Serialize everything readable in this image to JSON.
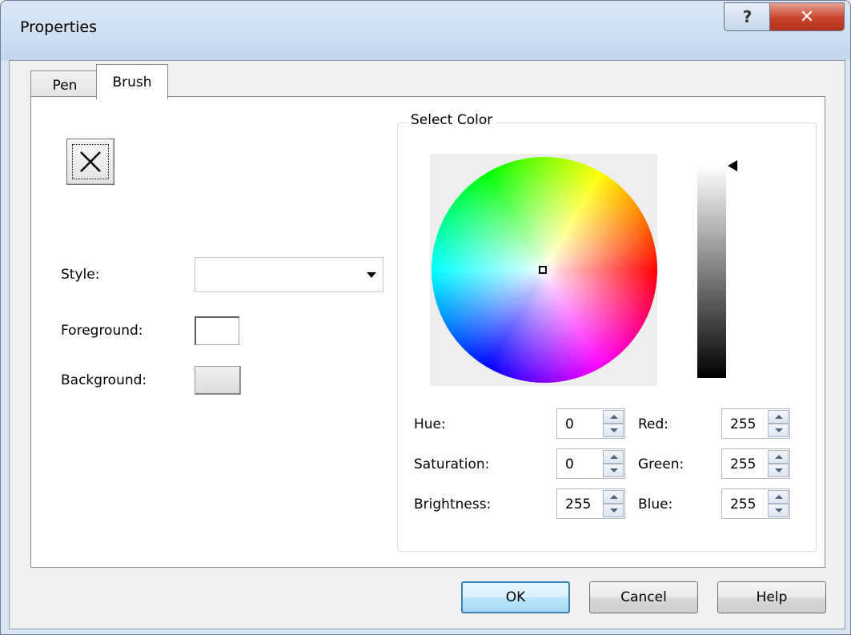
{
  "window": {
    "title": "Properties",
    "help_glyph": "?",
    "close_glyph": "✕"
  },
  "tabs": [
    {
      "label": "Pen"
    },
    {
      "label": "Brush"
    }
  ],
  "brush": {
    "preview_glyph": "✕",
    "style_label": "Style:",
    "style_value": "",
    "foreground_label": "Foreground:",
    "foreground_color": "#ffffff",
    "background_label": "Background:",
    "background_color": "#e6e6e6"
  },
  "select_color": {
    "title": "Select Color",
    "fields": {
      "hue": {
        "label": "Hue:",
        "value": "0"
      },
      "saturation": {
        "label": "Saturation:",
        "value": "0"
      },
      "brightness": {
        "label": "Brightness:",
        "value": "255"
      },
      "red": {
        "label": "Red:",
        "value": "255"
      },
      "green": {
        "label": "Green:",
        "value": "255"
      },
      "blue": {
        "label": "Blue:",
        "value": "255"
      }
    }
  },
  "buttons": {
    "ok": "OK",
    "cancel": "Cancel",
    "help": "Help"
  }
}
